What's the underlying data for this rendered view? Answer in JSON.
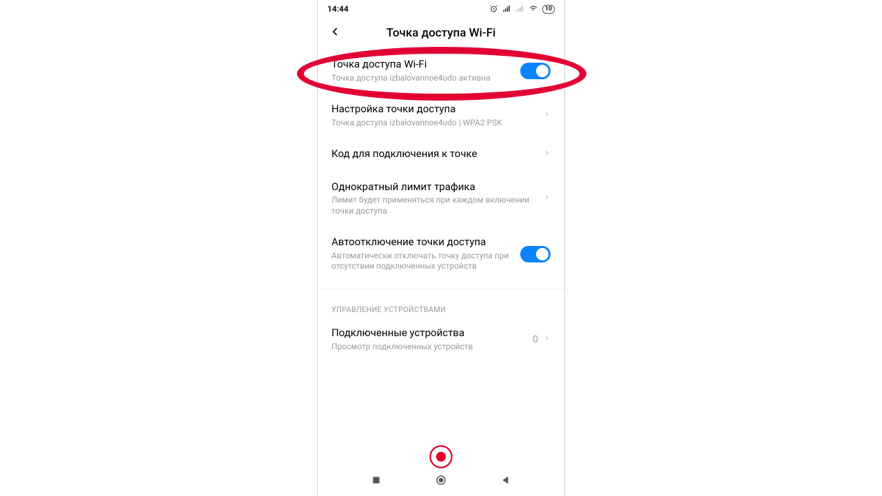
{
  "status": {
    "time": "14:44",
    "battery": "10"
  },
  "header": {
    "title": "Точка доступа Wi-Fi"
  },
  "items": {
    "hotspot_toggle": {
      "title": "Точка доступа Wi-Fi",
      "sub": "Точка доступа izbalovannoe4udo активна"
    },
    "hotspot_setup": {
      "title": "Настройка точки доступа",
      "sub": "Точка доступа izbalovannoe4udo | WPA2 PSK"
    },
    "qr_code": {
      "title": "Код для подключения к точке"
    },
    "one_time_limit": {
      "title": "Однократный лимит трафика",
      "sub": "Лимит будет применяться при каждом включении точки доступа"
    },
    "auto_off": {
      "title": "Автоотключение точки доступа",
      "sub": "Автоматически отключать точку доступа при отсутствии подключенных устройств"
    },
    "connected": {
      "title": "Подключенные устройства",
      "sub": "Просмотр подключенных устройств",
      "count": "0"
    }
  },
  "section": {
    "device_mgmt": "УПРАВЛЕНИЕ УСТРОЙСТВАМИ"
  }
}
